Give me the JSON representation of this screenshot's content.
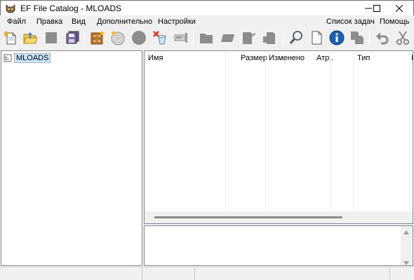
{
  "window": {
    "title": "EF File Catalog - MLOADS",
    "app_icon": "cat-face-icon",
    "controls": [
      "minimize-icon",
      "maximize-icon",
      "close-icon"
    ]
  },
  "menu": {
    "items": [
      {
        "label": "Файл"
      },
      {
        "label": "Правка"
      },
      {
        "label": "Вид"
      },
      {
        "label": "Дополнительно"
      },
      {
        "label": "Настройки"
      },
      {
        "label": "Список задач"
      },
      {
        "label": "Помощь"
      }
    ]
  },
  "toolbar": {
    "buttons": [
      {
        "name": "new-catalog",
        "icon": "new-document-sparkle-icon"
      },
      {
        "name": "open-catalog",
        "icon": "open-folder-icon"
      },
      {
        "name": "stop",
        "icon": "stop-square-icon"
      },
      {
        "name": "save-all",
        "icon": "floppy-disks-icon"
      },
      {
        "name": "add-files",
        "icon": "cabinet-sparkle-icon"
      },
      {
        "name": "add-disk",
        "icon": "cd-disk-sparkle-icon"
      },
      {
        "name": "record",
        "icon": "circle-icon"
      },
      {
        "name": "delete",
        "icon": "delete-bin-icon"
      },
      {
        "name": "properties",
        "icon": "device-icon"
      },
      {
        "name": "folder",
        "icon": "folder-gray-icon"
      },
      {
        "name": "rename",
        "icon": "tag-icon"
      },
      {
        "name": "edit-file",
        "icon": "file-edit-icon"
      },
      {
        "name": "move",
        "icon": "file-move-icon"
      },
      {
        "name": "find",
        "icon": "magnifier-icon"
      },
      {
        "name": "new-page",
        "icon": "blank-page-icon"
      },
      {
        "name": "info",
        "icon": "info-icon"
      },
      {
        "name": "copy",
        "icon": "copy-pages-icon"
      },
      {
        "name": "undo",
        "icon": "undo-arrow-icon"
      },
      {
        "name": "cut",
        "icon": "scissors-icon"
      }
    ]
  },
  "tree": {
    "root_label": "MLOADS",
    "root_icon": "catalog-root-icon"
  },
  "list": {
    "columns": [
      {
        "label": "Имя"
      },
      {
        "label": "Размер"
      },
      {
        "label": "Изменено"
      },
      {
        "label": "Атр..."
      },
      {
        "label": "Тип"
      },
      {
        "label": "I"
      }
    ]
  },
  "status": {
    "segments": [
      "",
      "",
      "",
      ""
    ]
  }
}
